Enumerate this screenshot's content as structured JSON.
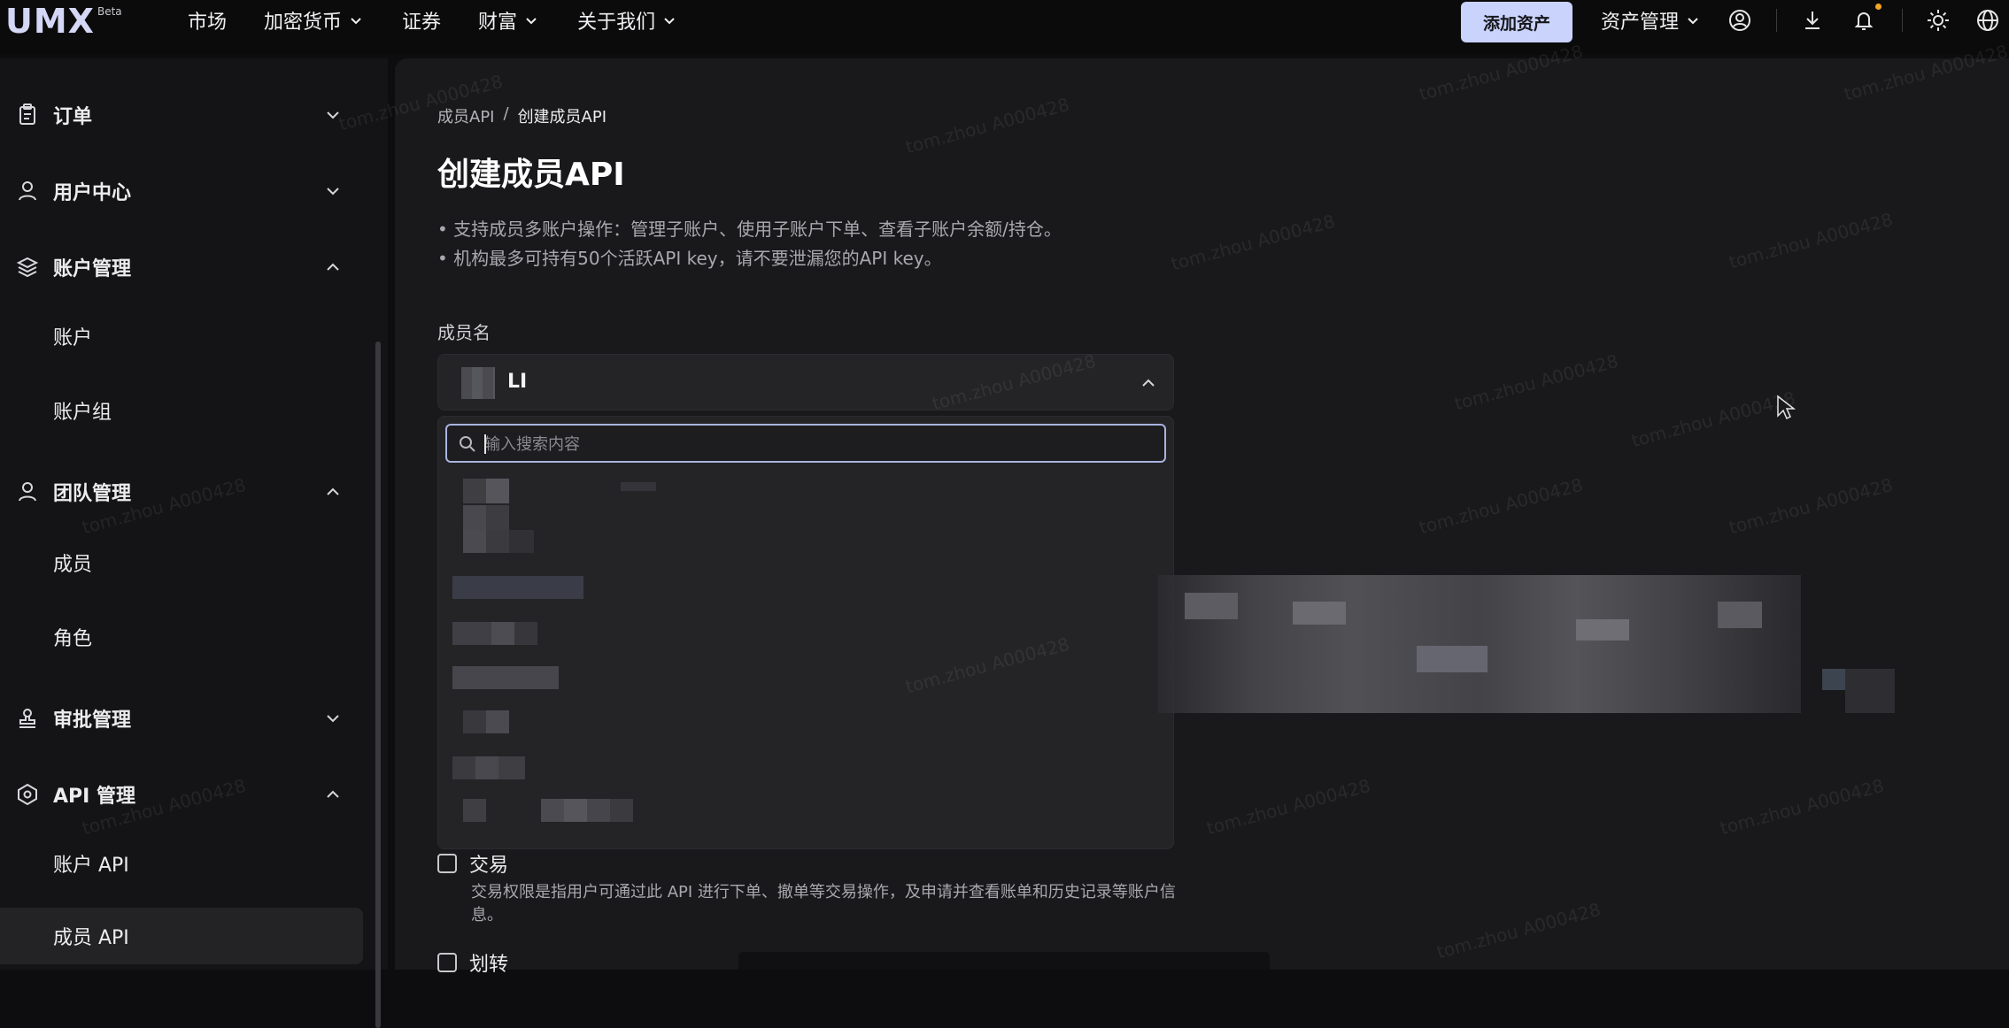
{
  "app": {
    "logo_text": "UMX",
    "logo_badge": "Beta"
  },
  "topnav": {
    "items": [
      {
        "label": "市场",
        "has_dropdown": false
      },
      {
        "label": "加密货币",
        "has_dropdown": true
      },
      {
        "label": "证券",
        "has_dropdown": false
      },
      {
        "label": "财富",
        "has_dropdown": true
      },
      {
        "label": "关于我们",
        "has_dropdown": true
      }
    ],
    "add_asset_label": "添加资产",
    "asset_mgmt_label": "资产管理",
    "icons": [
      "user-circle-icon",
      "download-icon",
      "bell-icon",
      "sun-icon",
      "globe-icon"
    ],
    "accent_color": "#c9d3fb",
    "notification_dot_color": "#f5a623"
  },
  "sidebar": {
    "groups": [
      {
        "label": "订单",
        "icon": "clipboard-icon",
        "expanded": false,
        "children": []
      },
      {
        "label": "用户中心",
        "icon": "user-icon",
        "expanded": false,
        "children": []
      },
      {
        "label": "账户管理",
        "icon": "layers-icon",
        "expanded": true,
        "children": [
          "账户",
          "账户组"
        ]
      },
      {
        "label": "团队管理",
        "icon": "team-icon",
        "expanded": true,
        "children": [
          "成员",
          "角色"
        ]
      },
      {
        "label": "审批管理",
        "icon": "stamp-icon",
        "expanded": false,
        "children": []
      },
      {
        "label": "API 管理",
        "icon": "hexagon-icon",
        "expanded": true,
        "children": [
          "账户 API",
          "成员 API"
        ]
      }
    ],
    "active_item": "成员 API"
  },
  "main": {
    "breadcrumb": [
      "成员API",
      "/",
      "创建成员API"
    ],
    "title": "创建成员API",
    "notes": [
      "• 支持成员多账户操作：管理子账户、使用子账户下单、查看子账户余额/持仓。",
      "• 机构最多可持有50个活跃API key，请不要泄漏您的API key。"
    ],
    "member_label": "成员名",
    "member_selected": "LI",
    "search_placeholder": "输入搜索内容",
    "permissions": [
      {
        "label": "交易",
        "checked": false,
        "description": "交易权限是指用户可通过此 API 进行下单、撤单等交易操作，及申请并查看账单和历史记录等账户信息。"
      },
      {
        "label": "划转",
        "checked": false,
        "description": ""
      }
    ]
  },
  "watermark_text": "tom.zhou A000428"
}
